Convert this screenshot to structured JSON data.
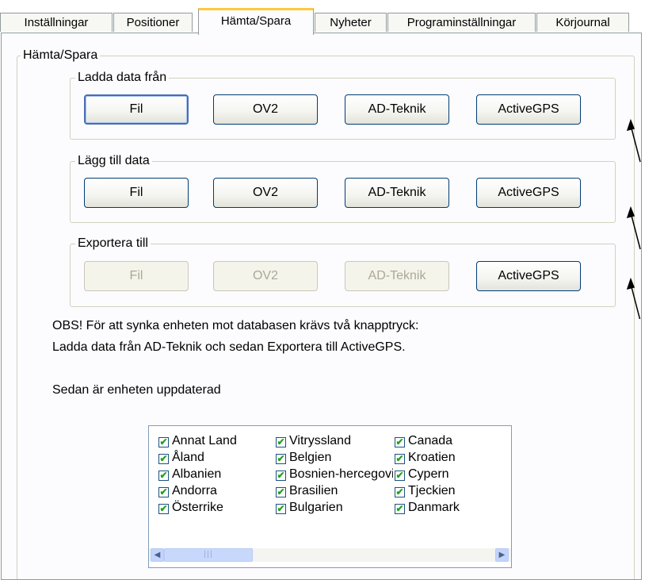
{
  "tabs": [
    {
      "label": "Inställningar"
    },
    {
      "label": "Positioner"
    },
    {
      "label": "Hämta/Spara"
    },
    {
      "label": "Nyheter"
    },
    {
      "label": "Programinställningar"
    },
    {
      "label": "Körjournal"
    }
  ],
  "main": {
    "group_title": "Hämta/Spara",
    "load": {
      "title": "Ladda data från",
      "buttons": [
        "Fil",
        "OV2",
        "AD-Teknik",
        "ActiveGPS"
      ]
    },
    "add": {
      "title": "Lägg till data",
      "buttons": [
        "Fil",
        "OV2",
        "AD-Teknik",
        "ActiveGPS"
      ]
    },
    "export": {
      "title": "Exportera till",
      "buttons": [
        "Fil",
        "OV2",
        "AD-Teknik",
        "ActiveGPS"
      ]
    },
    "note_line1": "OBS! För att synka enheten mot databasen krävs två knapptryck:",
    "note_line2": "Ladda data från AD-Teknik och sedan Exportera till ActiveGPS.",
    "note_line3": "Sedan är enheten uppdaterad"
  },
  "countries": [
    [
      "Annat Land",
      "Vitryssland",
      "Canada"
    ],
    [
      "Åland",
      "Belgien",
      "Kroatien"
    ],
    [
      "Albanien",
      "Bosnien-hercegovina",
      "Cypern"
    ],
    [
      "Andorra",
      "Brasilien",
      "Tjeckien"
    ],
    [
      "Österrike",
      "Bulgarien",
      "Danmark"
    ]
  ],
  "icons": {
    "checkbox": "check-icon",
    "scroll_left": "chevron-left-icon",
    "scroll_right": "chevron-right-icon"
  },
  "colors": {
    "active_tab_accent": "#ffc83c",
    "button_border": "#003c74",
    "checkmark": "#21a121"
  }
}
